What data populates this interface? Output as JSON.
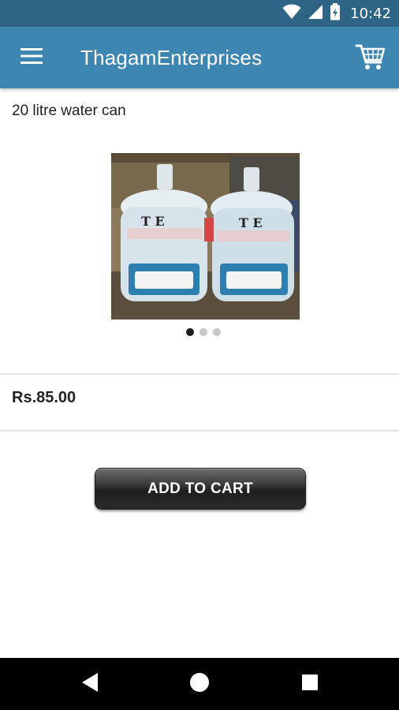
{
  "status_bar": {
    "time": "10:42"
  },
  "app_bar": {
    "title": "ThagamEnterprises"
  },
  "product": {
    "name": "20 litre water can",
    "price": "Rs.85.00",
    "image_count": 3,
    "active_image": 1
  },
  "actions": {
    "add_to_cart": "ADD TO CART"
  },
  "icons": {
    "menu": "hamburger-menu-icon",
    "cart": "shopping-cart-icon",
    "back": "back-triangle-icon",
    "home": "home-circle-icon",
    "recents": "recents-square-icon",
    "wifi": "wifi-icon",
    "signal": "cell-signal-icon",
    "battery": "battery-icon"
  },
  "colors": {
    "app_bar": "#3d86b1",
    "status_bar": "#2e6587",
    "button": "#2a2a2a"
  }
}
